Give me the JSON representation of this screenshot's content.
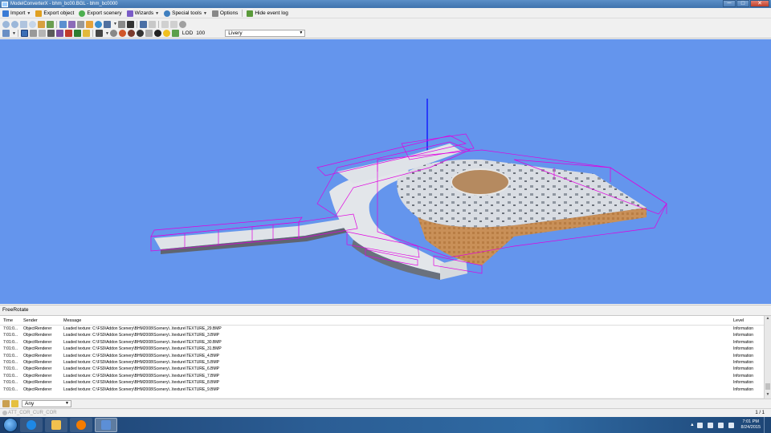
{
  "window": {
    "title": "ModelConverterX - bhm_bc00.BGL - bhm_bc0000",
    "buttons": {
      "minimize": "─",
      "maximize": "□",
      "close": "✕"
    }
  },
  "menubar": {
    "items": [
      {
        "label": "Import",
        "icon": "import-icon",
        "color": "#3a7bd5",
        "has_dropdown": true
      },
      {
        "label": "Export object",
        "icon": "export-object-icon",
        "color": "#e0a020",
        "has_dropdown": false
      },
      {
        "label": "Export scenery",
        "icon": "export-scenery-icon",
        "color": "#4caf50",
        "has_dropdown": false
      },
      {
        "label": "Wizards",
        "icon": "wizard-icon",
        "color": "#7a5cc7",
        "has_dropdown": true
      },
      {
        "label": "Special tools",
        "icon": "tools-icon",
        "color": "#3f7fbf",
        "has_dropdown": true
      },
      {
        "label": "Options",
        "icon": "options-icon",
        "color": "#888888",
        "has_dropdown": false
      },
      {
        "label": "Hide event log",
        "icon": "event-log-icon",
        "color": "#5a9a3a",
        "has_dropdown": false
      }
    ]
  },
  "toolbar": {
    "lod_label": "LOD",
    "lod_value": "100",
    "livery_value": "Livery"
  },
  "viewport": {
    "background": "#6495ed",
    "bbox_color": "#e000e0",
    "axis_color": "#0000ff"
  },
  "panel": {
    "title": "FreeRotate"
  },
  "log": {
    "columns": {
      "time": "Time",
      "sender": "Sender",
      "message": "Message",
      "level": "Level"
    },
    "rows": [
      {
        "time": "7:01:0...",
        "sender": "ObjectRenderer",
        "message": "Loaded texture: C:\\FS9\\Addon Scenery\\BHM2008\\Scenery\\..\\texture\\TEXTURE_29.BMP",
        "level": "Information"
      },
      {
        "time": "7:01:0...",
        "sender": "ObjectRenderer",
        "message": "Loaded texture: C:\\FS9\\Addon Scenery\\BHM2008\\Scenery\\..\\texture\\TEXTURE_3.BMP",
        "level": "Information"
      },
      {
        "time": "7:01:0...",
        "sender": "ObjectRenderer",
        "message": "Loaded texture: C:\\FS9\\Addon Scenery\\BHM2008\\Scenery\\..\\texture\\TEXTURE_30.BMP",
        "level": "Information"
      },
      {
        "time": "7:01:0...",
        "sender": "ObjectRenderer",
        "message": "Loaded texture: C:\\FS9\\Addon Scenery\\BHM2008\\Scenery\\..\\texture\\TEXTURE_31.BMP",
        "level": "Information"
      },
      {
        "time": "7:01:0...",
        "sender": "ObjectRenderer",
        "message": "Loaded texture: C:\\FS9\\Addon Scenery\\BHM2008\\Scenery\\..\\texture\\TEXTURE_4.BMP",
        "level": "Information"
      },
      {
        "time": "7:01:0...",
        "sender": "ObjectRenderer",
        "message": "Loaded texture: C:\\FS9\\Addon Scenery\\BHM2008\\Scenery\\..\\texture\\TEXTURE_5.BMP",
        "level": "Information"
      },
      {
        "time": "7:01:0...",
        "sender": "ObjectRenderer",
        "message": "Loaded texture: C:\\FS9\\Addon Scenery\\BHM2008\\Scenery\\..\\texture\\TEXTURE_6.BMP",
        "level": "Information"
      },
      {
        "time": "7:01:0...",
        "sender": "ObjectRenderer",
        "message": "Loaded texture: C:\\FS9\\Addon Scenery\\BHM2008\\Scenery\\..\\texture\\TEXTURE_7.BMP",
        "level": "Information"
      },
      {
        "time": "7:01:0...",
        "sender": "ObjectRenderer",
        "message": "Loaded texture: C:\\FS9\\Addon Scenery\\BHM2008\\Scenery\\..\\texture\\TEXTURE_8.BMP",
        "level": "Information"
      },
      {
        "time": "7:01:0...",
        "sender": "ObjectRenderer",
        "message": "Loaded texture: C:\\FS9\\Addon Scenery\\BHM2008\\Scenery\\..\\texture\\TEXTURE_9.BMP",
        "level": "Information"
      }
    ]
  },
  "filter": {
    "value": "Any"
  },
  "status": {
    "text": "ATT_COR_CUR_COR",
    "page": "1 / 1"
  },
  "taskbar": {
    "apps": [
      {
        "name": "internet-explorer",
        "color": "#1e88e5",
        "active": false
      },
      {
        "name": "file-explorer",
        "color": "#f2c14e",
        "active": false
      },
      {
        "name": "media-player",
        "color": "#f57c00",
        "active": false
      },
      {
        "name": "model-converter-x",
        "color": "#5c8fd6",
        "active": true
      }
    ],
    "time": "7:01 PM",
    "date": "8/24/2015"
  }
}
